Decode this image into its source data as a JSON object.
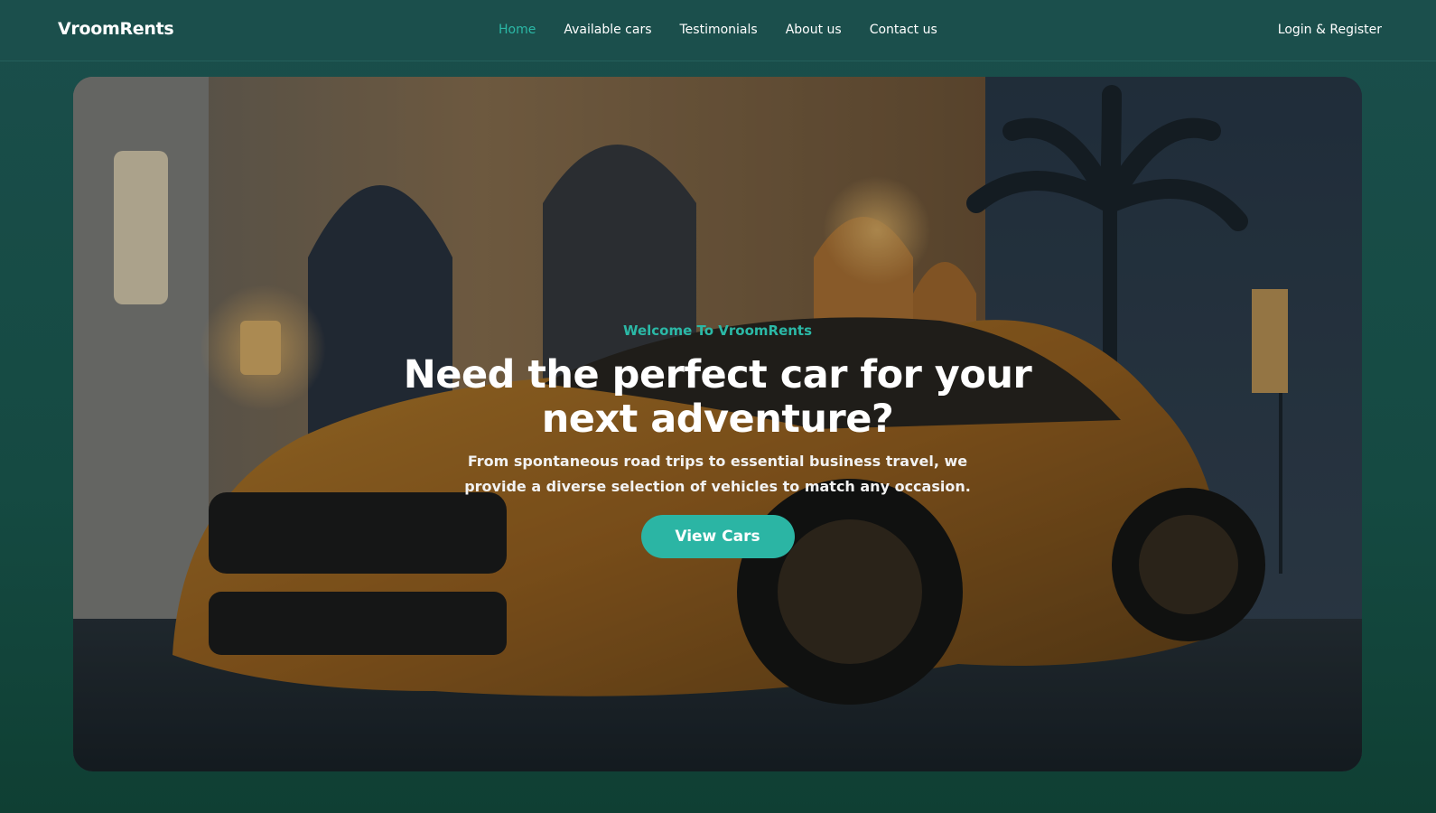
{
  "nav": {
    "brand": "VroomRents",
    "links": [
      {
        "label": "Home",
        "active": true
      },
      {
        "label": "Available cars",
        "active": false
      },
      {
        "label": "Testimonials",
        "active": false
      },
      {
        "label": "About us",
        "active": false
      },
      {
        "label": "Contact us",
        "active": false
      }
    ],
    "login_label": "Login & Register"
  },
  "hero": {
    "eyebrow": "Welcome To VroomRents",
    "headline": "Need the perfect car for your next adventure?",
    "subtext": "From spontaneous road trips to essential business travel, we provide a diverse selection of vehicles to match any occasion.",
    "cta_label": "View Cars",
    "background_image": "sports car parked in front of a lit arched building at dusk with palm tree"
  },
  "colors": {
    "accent": "#2bb8a6",
    "navbar_bg": "#1b4f4c",
    "page_bg": "#154a42",
    "text": "#ffffff"
  }
}
